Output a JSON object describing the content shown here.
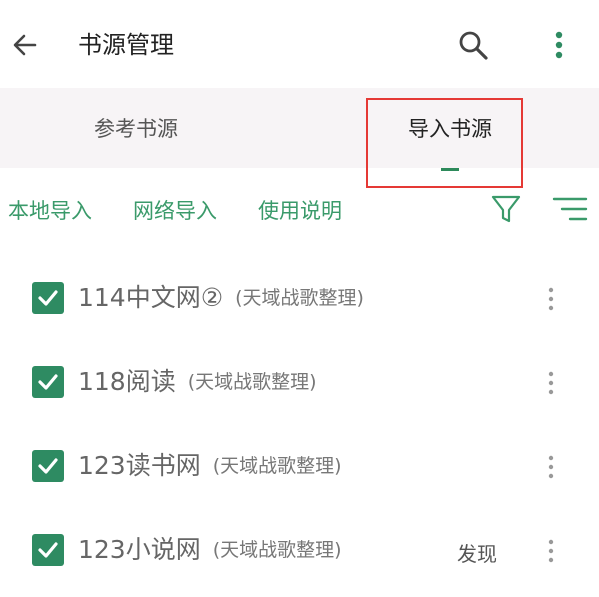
{
  "appbar": {
    "title": "书源管理"
  },
  "tabs": [
    {
      "label": "参考书源",
      "active": false
    },
    {
      "label": "导入书源",
      "active": true
    }
  ],
  "actions": [
    {
      "label": "本地导入"
    },
    {
      "label": "网络导入"
    },
    {
      "label": "使用说明"
    }
  ],
  "sources": [
    {
      "name": "114中文网②",
      "note": "(天域战歌整理)",
      "checked": true,
      "discover": ""
    },
    {
      "name": "118阅读",
      "note": "(天域战歌整理)",
      "checked": true,
      "discover": ""
    },
    {
      "name": "123读书网",
      "note": "(天域战歌整理)",
      "checked": true,
      "discover": ""
    },
    {
      "name": "123小说网",
      "note": "(天域战歌整理)",
      "checked": true,
      "discover": "发现"
    }
  ],
  "colors": {
    "accent": "#2e8b62",
    "highlight": "#e53935"
  },
  "icons": {
    "back": "arrow-left-icon",
    "search": "search-icon",
    "more": "more-vert-icon",
    "filter": "filter-icon",
    "sort": "sort-icon",
    "check": "check-icon"
  }
}
